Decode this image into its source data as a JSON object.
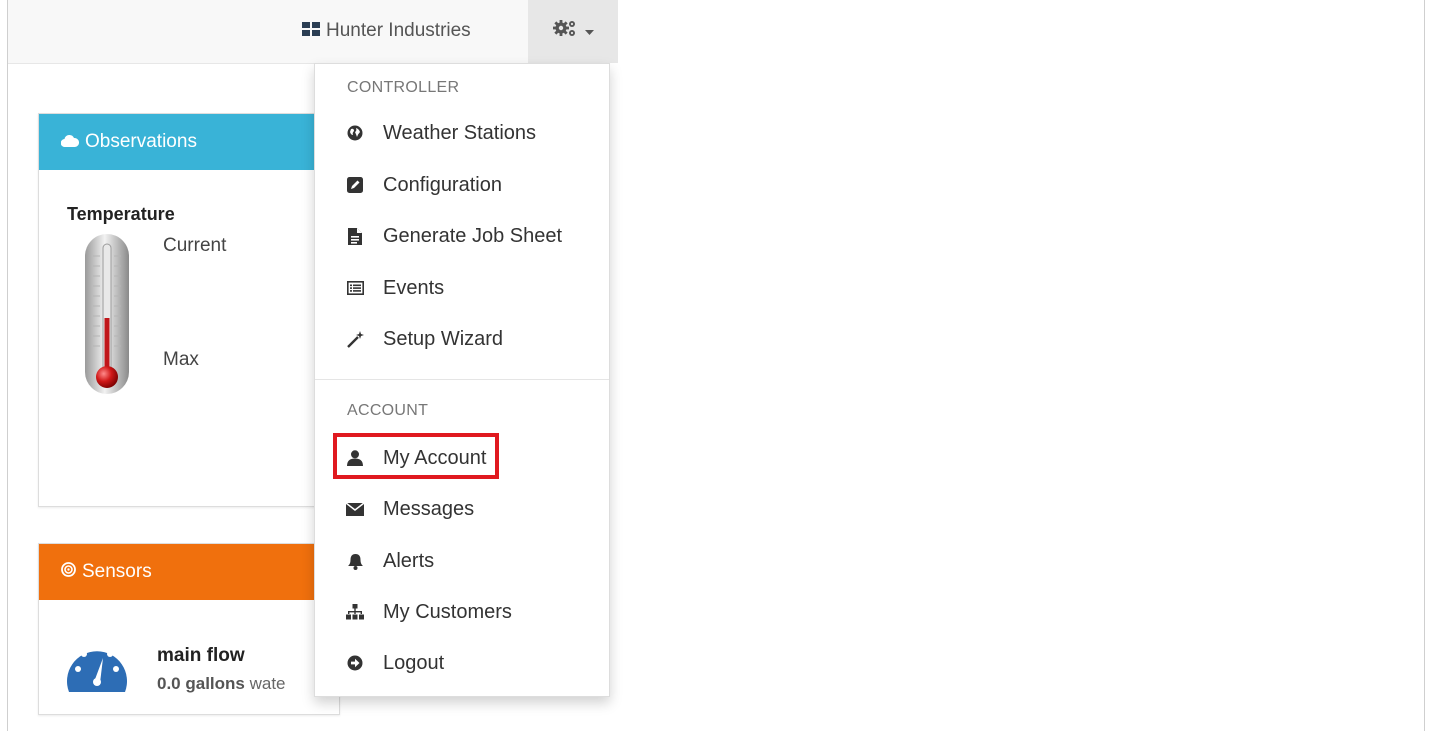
{
  "navbar": {
    "brand": "Hunter Industries",
    "brand_icon": "grid-icon",
    "settings_icon": "gears-icon"
  },
  "observations": {
    "title": "Observations",
    "icon": "cloud-icon",
    "temperature_label": "Temperature",
    "current_label": "Current",
    "max_label": "Max"
  },
  "sensors": {
    "title": "Sensors",
    "icon": "bullseye-icon",
    "sensor_name": "main flow",
    "sensor_value": "0.0 gallons",
    "sensor_suffix": " wate"
  },
  "menu": {
    "controller_header": "CONTROLLER",
    "controller_items": [
      {
        "label": "Weather Stations",
        "icon": "globe-icon"
      },
      {
        "label": "Configuration",
        "icon": "edit-icon"
      },
      {
        "label": "Generate Job Sheet",
        "icon": "file-icon"
      },
      {
        "label": "Events",
        "icon": "list-icon"
      },
      {
        "label": "Setup Wizard",
        "icon": "magic-wand-icon"
      }
    ],
    "account_header": "ACCOUNT",
    "account_items": [
      {
        "label": "My Account",
        "icon": "user-icon"
      },
      {
        "label": "Messages",
        "icon": "envelope-icon"
      },
      {
        "label": "Alerts",
        "icon": "bell-icon"
      },
      {
        "label": "My Customers",
        "icon": "sitemap-icon"
      },
      {
        "label": "Logout",
        "icon": "logout-icon"
      }
    ]
  },
  "colors": {
    "observations_header": "#39b3d7",
    "sensors_header": "#f0700d",
    "highlight_box": "#e0191f"
  }
}
